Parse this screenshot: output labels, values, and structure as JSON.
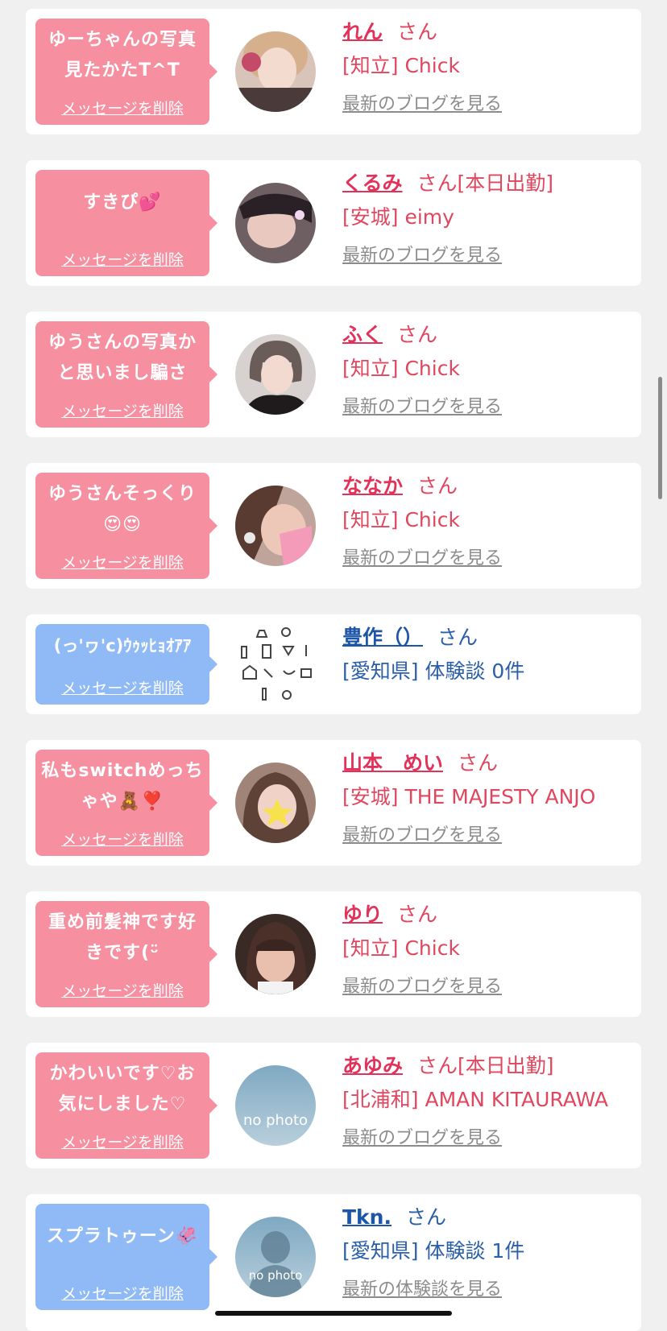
{
  "colors": {
    "page_bg": "#f0f0f0",
    "pink_bubble": "#f68fa0",
    "blue_bubble": "#8fbaf5",
    "pink_text": "#e0475f",
    "blue_text": "#2b5fa7",
    "link_gray": "#8c8c8c"
  },
  "messages": [
    {
      "message": "ゆーちゃんの写真見たかたT^T",
      "delete_label": "メッセージを削除",
      "name": "れん",
      "honorific": "さん",
      "area": "[知立]",
      "shop": "Chick",
      "link": "最新のブログを見る",
      "avatar": "photo-avatar"
    },
    {
      "message": "すきぴ💕",
      "delete_label": "メッセージを削除",
      "name": "くるみ",
      "honorific": "さん[本日出勤]",
      "area": "[安城]",
      "shop": "eimy",
      "link": "最新のブログを見る",
      "avatar": "photo-avatar"
    },
    {
      "message": "ゆうさんの写真かと思いまし騙さ",
      "delete_label": "メッセージを削除",
      "name": "ふく",
      "honorific": "さん",
      "area": "[知立]",
      "shop": "Chick",
      "link": "最新のブログを見る",
      "avatar": "photo-avatar"
    },
    {
      "message": "ゆうさんそっくり😍😍",
      "delete_label": "メッセージを削除",
      "name": "ななか",
      "honorific": "さん",
      "area": "[知立]",
      "shop": "Chick",
      "link": "最新のブログを見る",
      "avatar": "photo-avatar"
    },
    {
      "message": "(っ'ヮ'c)ｳｩｯﾋｮｵｱｱ",
      "delete_label": "メッセージを削除",
      "name": "豊作（）",
      "honorific": "さん",
      "area": "[愛知県]",
      "shop": "体験談 0件",
      "avatar": "doodle-icons-avatar"
    },
    {
      "message": "私もswitchめっちゃや🧸❣️",
      "delete_label": "メッセージを削除",
      "name": "山本　めい",
      "honorific": "さん",
      "area": "[安城]",
      "shop": "THE MAJESTY ANJO",
      "link": "最新のブログを見る",
      "avatar": "photo-avatar"
    },
    {
      "message": "重め前髪神です好きです(ᵕ̈",
      "delete_label": "メッセージを削除",
      "name": "ゆり",
      "honorific": "さん",
      "area": "[知立]",
      "shop": "Chick",
      "link": "最新のブログを見る",
      "avatar": "photo-avatar"
    },
    {
      "message": "かわいいです♡お気にしました♡",
      "delete_label": "メッセージを削除",
      "name": "あゆみ",
      "honorific": "さん[本日出勤]",
      "area": "[北浦和]",
      "shop": "AMAN KITAURAWA",
      "link": "最新のブログを見る",
      "avatar": "no-photo-avatar",
      "avatar_text": "no photo"
    },
    {
      "message": "スプラトゥーン🦑",
      "delete_label": "メッセージを削除",
      "name": "Tkn.",
      "honorific": "さん",
      "area": "[愛知県]",
      "shop": "体験談 1件",
      "link": "最新の体験談を見る",
      "avatar": "no-photo-silhouette-avatar",
      "avatar_text": "no photo"
    }
  ]
}
